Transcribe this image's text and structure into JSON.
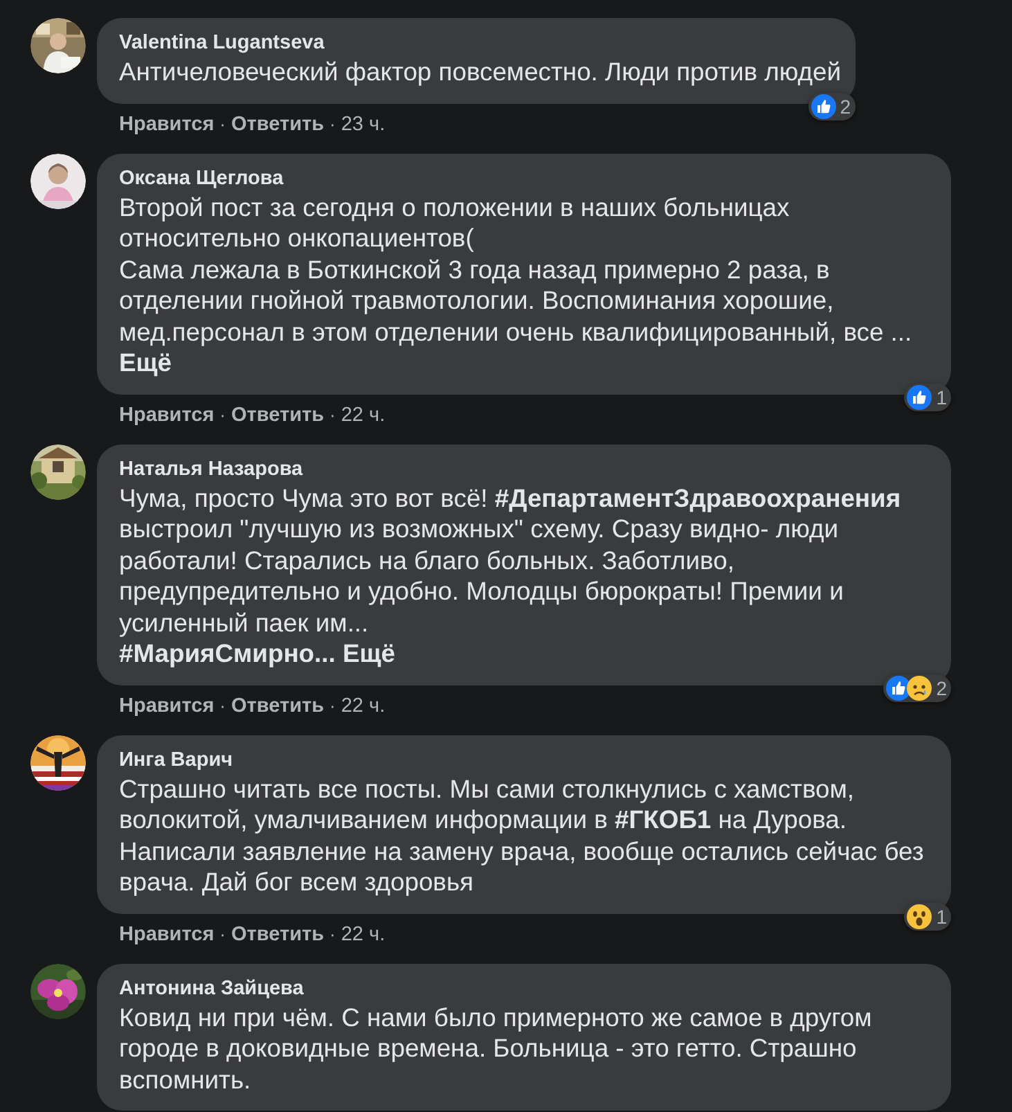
{
  "comments": [
    {
      "author": "Valentina Lugantseva",
      "avatar": {
        "kind": "picture"
      },
      "text": "Античеловеческий фактор повсеместно. Люди против людей",
      "actions": {
        "like": "Нравится",
        "separator": "·",
        "reply": "Ответить",
        "time": "23 ч."
      },
      "reactions": [
        {
          "kind": "like"
        }
      ],
      "reaction_count": "2"
    },
    {
      "author": "Оксана Щеглова",
      "avatar": {
        "kind": "picture"
      },
      "text": "Второй пост за сегодня о положении в наших больницах относительно онкопациентов(\nСама лежала в Боткинской 3 года назад примерно 2 раза, в отделении гнойной травмотологии. Воспоминания хорошие, мед.персонал в этом отделении очень квалифицированный, все ...\n",
      "more": "Ещё",
      "actions": {
        "like": "Нравится",
        "separator": "·",
        "reply": "Ответить",
        "time": "22 ч."
      },
      "reactions": [
        {
          "kind": "like"
        }
      ],
      "reaction_count": "1"
    },
    {
      "author": "Наталья Назарова",
      "avatar": {
        "kind": "picture"
      },
      "text": "Чума, просто Чума это вот всё! **#ДепартаментЗдравоохранения** выстроил \"лучшую из возможных\" схему. Сразу видно- люди работали! Старались на благо больных. Заботливо, предупредительно и удобно. Молодцы бюрократы! Премии и усиленный паек им...\n**#МарияСмирно...** ",
      "more": "Ещё",
      "actions": {
        "like": "Нравится",
        "separator": "·",
        "reply": "Ответить",
        "time": "22 ч."
      },
      "reactions": [
        {
          "kind": "like"
        },
        {
          "kind": "sad"
        }
      ],
      "reaction_count": "2"
    },
    {
      "author": "Инга Варич",
      "avatar": {
        "kind": "picture"
      },
      "text": "Страшно читать все посты. Мы сами столкнулись с хамством, волокитой, умалчиванием информации в **#ГКОБ1** на Дурова. Написали заявление на замену врача, вообще остались сейчас без врача. Дай бог всем здоровья",
      "actions": {
        "like": "Нравится",
        "separator": "·",
        "reply": "Ответить",
        "time": "22 ч."
      },
      "reactions": [
        {
          "kind": "wow"
        }
      ],
      "reaction_count": "1"
    },
    {
      "author": "Антонина Зайцева",
      "avatar": {
        "kind": "picture"
      },
      "text": "Ковид ни при чём. С нами было примерното же самое в другом городе в доковидные времена. Больница - это гетто. Страшно вспомнить."
    }
  ]
}
